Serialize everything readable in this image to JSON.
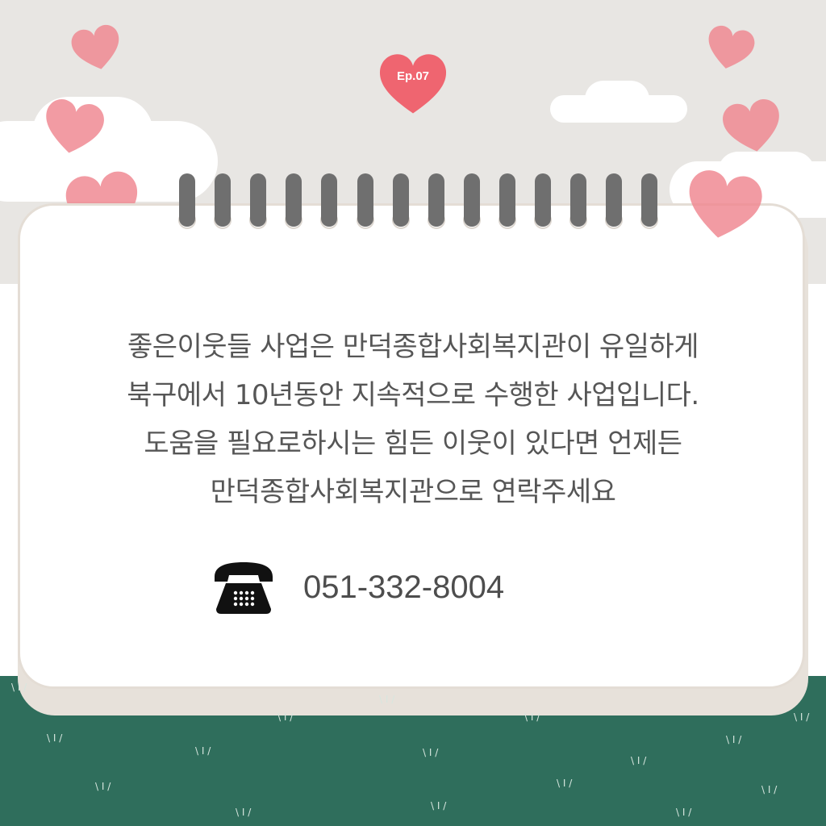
{
  "badge": {
    "label": "Ep.07",
    "color": "#ef6570"
  },
  "message": {
    "lines": [
      "좋은이웃들 사업은 만덕종합사회복지관이 유일하게",
      "북구에서 10년동안 지속적으로 수행한 사업입니다.",
      "도움을 필요로하시는 힘든 이웃이 있다면 언제든",
      "만덕종합사회복지관으로 연락주세요"
    ]
  },
  "contact": {
    "icon": "telephone-icon",
    "phone": "051-332-8004"
  },
  "colors": {
    "sky": "#e8e6e3",
    "grass": "#2f6e5c",
    "ring": "#6f6f6f",
    "heart": "#f08a93",
    "text": "#565656"
  },
  "decor": {
    "heart_icon": "heart-icon",
    "cloud_icon": "cloud-icon",
    "ring_count": 14
  }
}
